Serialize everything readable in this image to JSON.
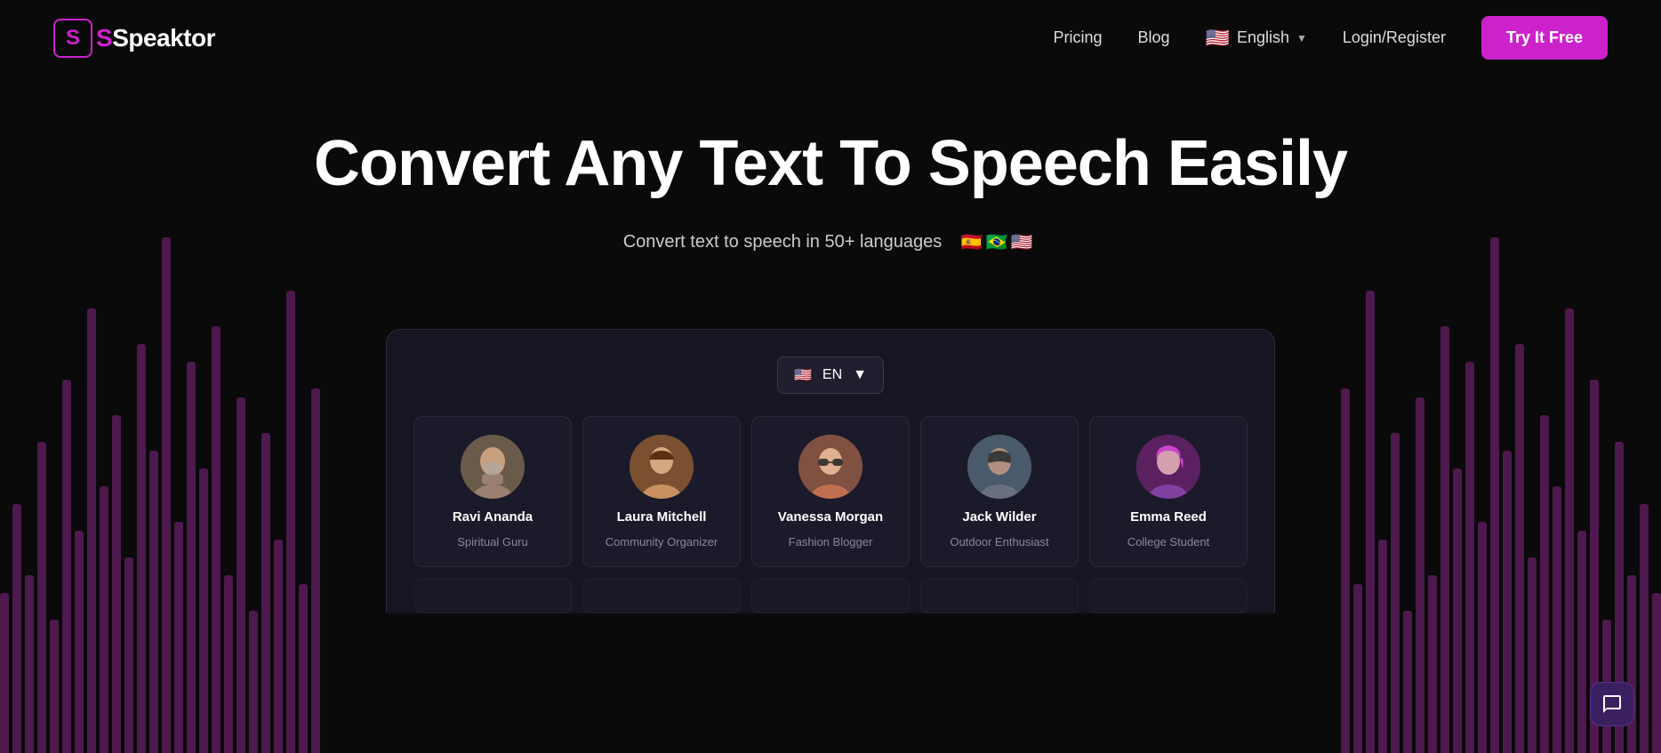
{
  "logo": {
    "icon_letter": "S",
    "text_prefix": "",
    "text": "Speaktor"
  },
  "nav": {
    "pricing_label": "Pricing",
    "blog_label": "Blog",
    "language_label": "English",
    "login_label": "Login/Register",
    "cta_label": "Try It Free"
  },
  "hero": {
    "title": "Convert Any Text To Speech Easily",
    "subtitle": "Convert text to speech in 50+ languages",
    "flags": [
      "🇪🇸",
      "🇧🇷",
      "🇺🇸"
    ]
  },
  "demo": {
    "lang_code": "EN",
    "lang_flag": "🇺🇸"
  },
  "voices": [
    {
      "id": "ravi",
      "name": "Ravi Ananda",
      "role": "Spiritual Guru",
      "avatar_emoji": "🧔",
      "avatar_class": "avatar-ravi"
    },
    {
      "id": "laura",
      "name": "Laura Mitchell",
      "role": "Community Organizer",
      "avatar_emoji": "👩",
      "avatar_class": "avatar-laura"
    },
    {
      "id": "vanessa",
      "name": "Vanessa Morgan",
      "role": "Fashion Blogger",
      "avatar_emoji": "👩‍🦳",
      "avatar_class": "avatar-vanessa"
    },
    {
      "id": "jack",
      "name": "Jack Wilder",
      "role": "Outdoor Enthusiast",
      "avatar_emoji": "🧑",
      "avatar_class": "avatar-jack"
    },
    {
      "id": "emma",
      "name": "Emma Reed",
      "role": "College Student",
      "avatar_emoji": "👩‍🦱",
      "avatar_class": "avatar-emma"
    }
  ],
  "colors": {
    "accent": "#cc22cc",
    "background": "#0a0a0a",
    "panel": "#161622",
    "card": "#1a1a2a"
  }
}
